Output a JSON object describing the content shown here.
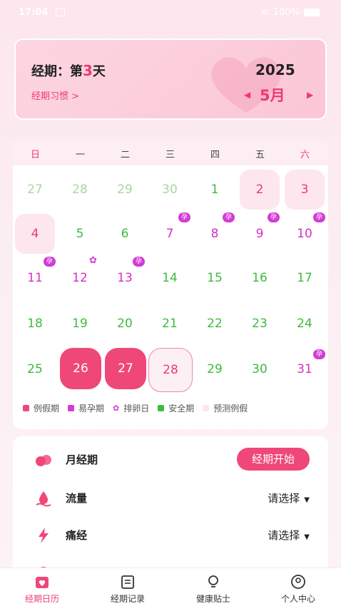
{
  "status": {
    "time": "17:04",
    "battery": "100%"
  },
  "header": {
    "period_prefix": "经期：第",
    "period_day": "3",
    "period_suffix": "天",
    "habit_link": "经期习惯 >",
    "year": "2025",
    "month": "5月",
    "prev_arrow": "◀",
    "next_arrow": "▶"
  },
  "calendar": {
    "weekdays": [
      "日",
      "一",
      "二",
      "三",
      "四",
      "五",
      "六"
    ],
    "rows": [
      [
        "27",
        "28",
        "29",
        "30",
        "1",
        "2",
        "3"
      ],
      [
        "4",
        "5",
        "6",
        "7",
        "8",
        "9",
        "10"
      ],
      [
        "11",
        "12",
        "13",
        "14",
        "15",
        "16",
        "17"
      ],
      [
        "18",
        "19",
        "20",
        "21",
        "22",
        "23",
        "24"
      ],
      [
        "25",
        "26",
        "27",
        "28",
        "29",
        "30",
        "31"
      ]
    ],
    "badge_label": "孕",
    "flower_glyph": "✿"
  },
  "legend": [
    {
      "label": "例假期",
      "color": "#ef4778"
    },
    {
      "label": "易孕期",
      "color": "#d43ad6"
    },
    {
      "label": "排卵日",
      "color": "#d43ad6"
    },
    {
      "label": "安全期",
      "color": "#3dbb3d"
    },
    {
      "label": "预测例假",
      "color": "#fde6ee"
    }
  ],
  "records": {
    "period": {
      "label": "月经期",
      "button": "经期开始"
    },
    "flow": {
      "label": "流量",
      "value": "请选择"
    },
    "pain": {
      "label": "痛经",
      "value": "请选择"
    }
  },
  "tabs": [
    {
      "label": "经期日历",
      "icon": "calendar-heart-icon"
    },
    {
      "label": "经期记录",
      "icon": "notebook-icon"
    },
    {
      "label": "健康贴士",
      "icon": "lightbulb-icon"
    },
    {
      "label": "个人中心",
      "icon": "user-icon"
    }
  ],
  "colors": {
    "accent": "#ef4778",
    "fertile": "#d43ad6",
    "safe": "#3dbb3d"
  }
}
